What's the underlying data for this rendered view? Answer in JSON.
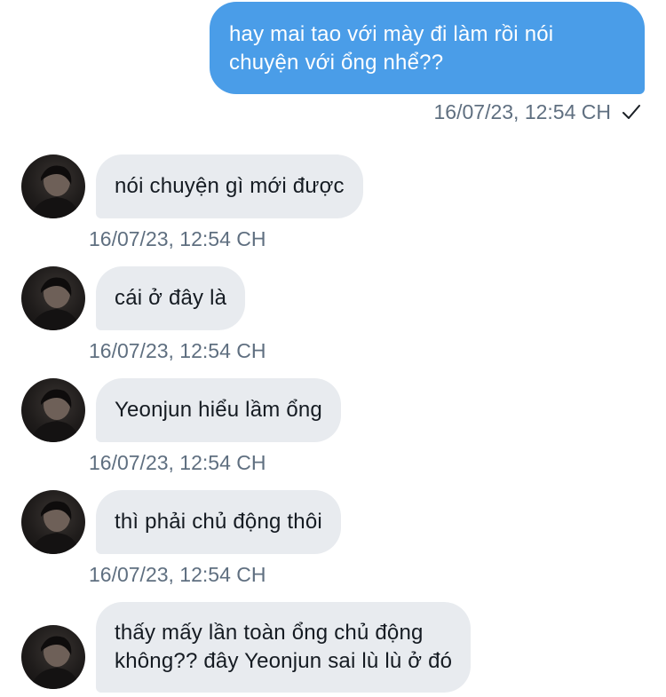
{
  "outgoing": {
    "text_line1": "hay mai tao với mày đi làm rồi nói",
    "text_line2": "chuyện với ổng nhể??",
    "timestamp": "16/07/23, 12:54 CH",
    "status_icon": "checkmark-icon"
  },
  "incoming": [
    {
      "text": "nói chuyện gì mới được",
      "timestamp": "16/07/23, 12:54 CH"
    },
    {
      "text": "cái ở đây là",
      "timestamp": "16/07/23, 12:54 CH"
    },
    {
      "text": "Yeonjun hiểu lầm ổng",
      "timestamp": "16/07/23, 12:54 CH"
    },
    {
      "text": "thì phải chủ động thôi",
      "timestamp": "16/07/23, 12:54 CH"
    },
    {
      "text_line1": "thấy mấy lần toàn ổng chủ động",
      "text_line2": "không?? đây Yeonjun sai lù lù ở đó"
    }
  ],
  "colors": {
    "outgoing_bubble": "#4a9de8",
    "incoming_bubble": "#e8ebef",
    "timestamp": "#5f6f80"
  }
}
